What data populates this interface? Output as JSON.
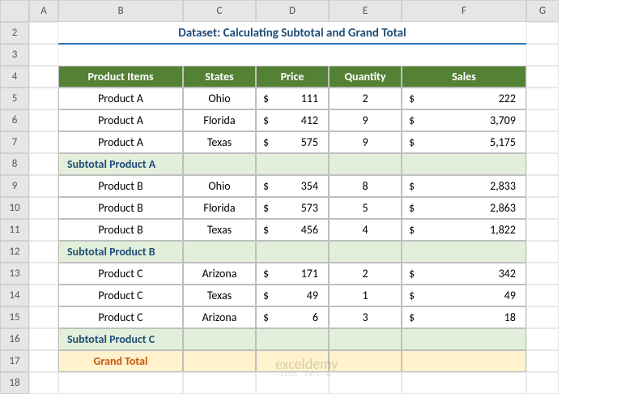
{
  "columns": [
    "A",
    "B",
    "C",
    "D",
    "E",
    "F",
    "G"
  ],
  "row_numbers": [
    2,
    3,
    4,
    5,
    6,
    7,
    8,
    9,
    10,
    11,
    12,
    13,
    14,
    15,
    16,
    17,
    18
  ],
  "title": "Dataset: Calculating Subtotal and Grand Total",
  "headers": {
    "product": "Product Items",
    "states": "States",
    "price": "Price",
    "quantity": "Quantity",
    "sales": "Sales"
  },
  "currency_symbol": "$",
  "rows": [
    {
      "product": "Product A",
      "state": "Ohio",
      "price": "111",
      "qty": "2",
      "sales": "222"
    },
    {
      "product": "Product A",
      "state": "Florida",
      "price": "412",
      "qty": "9",
      "sales": "3,709"
    },
    {
      "product": "Product A",
      "state": "Texas",
      "price": "575",
      "qty": "9",
      "sales": "5,175"
    }
  ],
  "subtotal_a": "Subtotal Product A",
  "rows_b": [
    {
      "product": "Product B",
      "state": "Ohio",
      "price": "354",
      "qty": "8",
      "sales": "2,833"
    },
    {
      "product": "Product B",
      "state": "Florida",
      "price": "573",
      "qty": "5",
      "sales": "2,863"
    },
    {
      "product": "Product B",
      "state": "Texas",
      "price": "456",
      "qty": "4",
      "sales": "1,822"
    }
  ],
  "subtotal_b": "Subtotal Product B",
  "rows_c": [
    {
      "product": "Product C",
      "state": "Arizona",
      "price": "171",
      "qty": "2",
      "sales": "342"
    },
    {
      "product": "Product C",
      "state": "Texas",
      "price": "49",
      "qty": "1",
      "sales": "49"
    },
    {
      "product": "Product C",
      "state": "Arizona",
      "price": "6",
      "qty": "3",
      "sales": "18"
    }
  ],
  "subtotal_c": "Subtotal Product C",
  "grand_total": "Grand Total",
  "watermark": {
    "main": "exceldemy",
    "sub": "EXCEL · DATA · BI"
  },
  "chart_data": {
    "type": "table",
    "title": "Dataset: Calculating Subtotal and Grand Total",
    "columns": [
      "Product Items",
      "States",
      "Price",
      "Quantity",
      "Sales"
    ],
    "data": [
      [
        "Product A",
        "Ohio",
        111,
        2,
        222
      ],
      [
        "Product A",
        "Florida",
        412,
        9,
        3709
      ],
      [
        "Product A",
        "Texas",
        575,
        9,
        5175
      ],
      [
        "Product B",
        "Ohio",
        354,
        8,
        2833
      ],
      [
        "Product B",
        "Florida",
        573,
        5,
        2863
      ],
      [
        "Product B",
        "Texas",
        456,
        4,
        1822
      ],
      [
        "Product C",
        "Arizona",
        171,
        2,
        342
      ],
      [
        "Product C",
        "Texas",
        49,
        1,
        49
      ],
      [
        "Product C",
        "Arizona",
        6,
        3,
        18
      ]
    ],
    "subtotals": [
      "Subtotal Product A",
      "Subtotal Product B",
      "Subtotal Product C"
    ],
    "grand_total_label": "Grand Total"
  }
}
